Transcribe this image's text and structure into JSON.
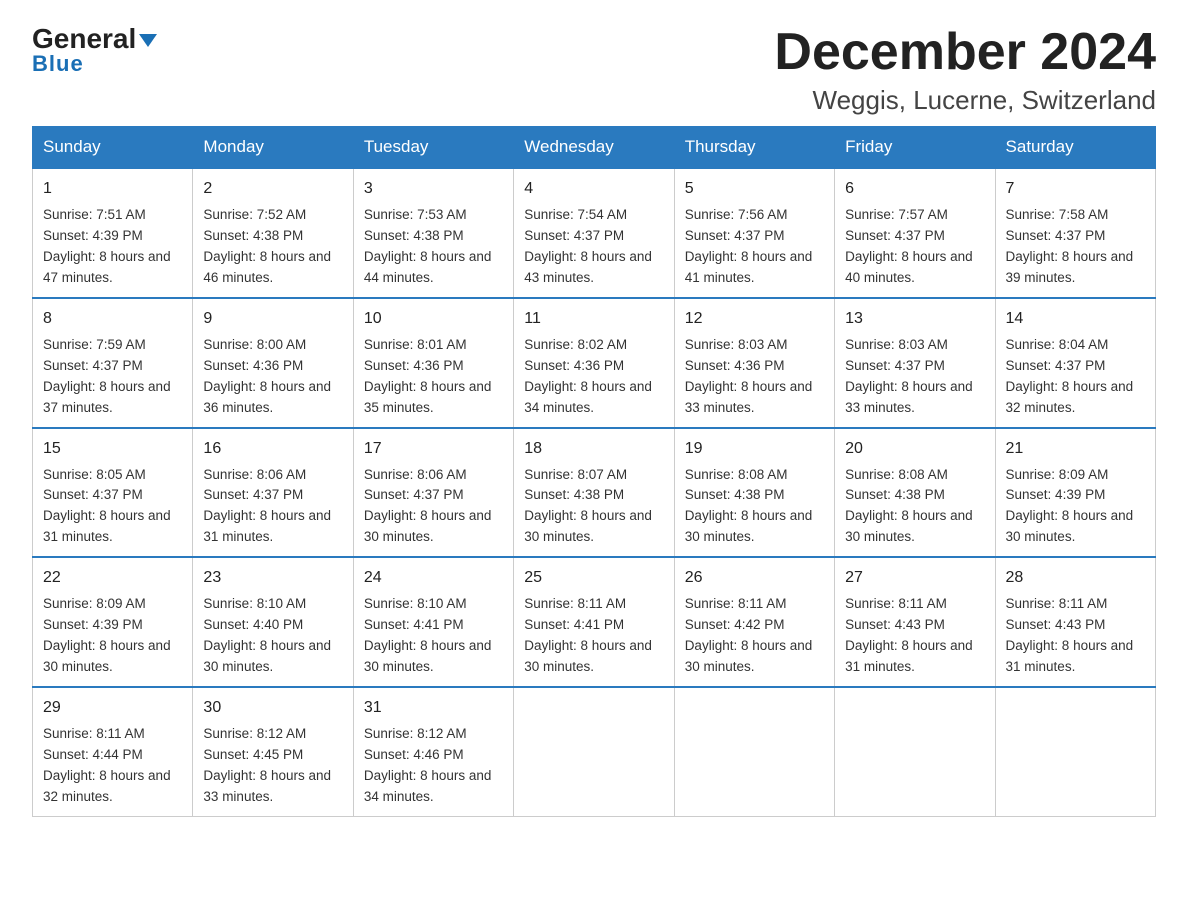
{
  "header": {
    "logo_general": "General",
    "logo_blue": "Blue",
    "title": "December 2024",
    "subtitle": "Weggis, Lucerne, Switzerland"
  },
  "days_of_week": [
    "Sunday",
    "Monday",
    "Tuesday",
    "Wednesday",
    "Thursday",
    "Friday",
    "Saturday"
  ],
  "weeks": [
    [
      {
        "day": "1",
        "sunrise": "Sunrise: 7:51 AM",
        "sunset": "Sunset: 4:39 PM",
        "daylight": "Daylight: 8 hours and 47 minutes."
      },
      {
        "day": "2",
        "sunrise": "Sunrise: 7:52 AM",
        "sunset": "Sunset: 4:38 PM",
        "daylight": "Daylight: 8 hours and 46 minutes."
      },
      {
        "day": "3",
        "sunrise": "Sunrise: 7:53 AM",
        "sunset": "Sunset: 4:38 PM",
        "daylight": "Daylight: 8 hours and 44 minutes."
      },
      {
        "day": "4",
        "sunrise": "Sunrise: 7:54 AM",
        "sunset": "Sunset: 4:37 PM",
        "daylight": "Daylight: 8 hours and 43 minutes."
      },
      {
        "day": "5",
        "sunrise": "Sunrise: 7:56 AM",
        "sunset": "Sunset: 4:37 PM",
        "daylight": "Daylight: 8 hours and 41 minutes."
      },
      {
        "day": "6",
        "sunrise": "Sunrise: 7:57 AM",
        "sunset": "Sunset: 4:37 PM",
        "daylight": "Daylight: 8 hours and 40 minutes."
      },
      {
        "day": "7",
        "sunrise": "Sunrise: 7:58 AM",
        "sunset": "Sunset: 4:37 PM",
        "daylight": "Daylight: 8 hours and 39 minutes."
      }
    ],
    [
      {
        "day": "8",
        "sunrise": "Sunrise: 7:59 AM",
        "sunset": "Sunset: 4:37 PM",
        "daylight": "Daylight: 8 hours and 37 minutes."
      },
      {
        "day": "9",
        "sunrise": "Sunrise: 8:00 AM",
        "sunset": "Sunset: 4:36 PM",
        "daylight": "Daylight: 8 hours and 36 minutes."
      },
      {
        "day": "10",
        "sunrise": "Sunrise: 8:01 AM",
        "sunset": "Sunset: 4:36 PM",
        "daylight": "Daylight: 8 hours and 35 minutes."
      },
      {
        "day": "11",
        "sunrise": "Sunrise: 8:02 AM",
        "sunset": "Sunset: 4:36 PM",
        "daylight": "Daylight: 8 hours and 34 minutes."
      },
      {
        "day": "12",
        "sunrise": "Sunrise: 8:03 AM",
        "sunset": "Sunset: 4:36 PM",
        "daylight": "Daylight: 8 hours and 33 minutes."
      },
      {
        "day": "13",
        "sunrise": "Sunrise: 8:03 AM",
        "sunset": "Sunset: 4:37 PM",
        "daylight": "Daylight: 8 hours and 33 minutes."
      },
      {
        "day": "14",
        "sunrise": "Sunrise: 8:04 AM",
        "sunset": "Sunset: 4:37 PM",
        "daylight": "Daylight: 8 hours and 32 minutes."
      }
    ],
    [
      {
        "day": "15",
        "sunrise": "Sunrise: 8:05 AM",
        "sunset": "Sunset: 4:37 PM",
        "daylight": "Daylight: 8 hours and 31 minutes."
      },
      {
        "day": "16",
        "sunrise": "Sunrise: 8:06 AM",
        "sunset": "Sunset: 4:37 PM",
        "daylight": "Daylight: 8 hours and 31 minutes."
      },
      {
        "day": "17",
        "sunrise": "Sunrise: 8:06 AM",
        "sunset": "Sunset: 4:37 PM",
        "daylight": "Daylight: 8 hours and 30 minutes."
      },
      {
        "day": "18",
        "sunrise": "Sunrise: 8:07 AM",
        "sunset": "Sunset: 4:38 PM",
        "daylight": "Daylight: 8 hours and 30 minutes."
      },
      {
        "day": "19",
        "sunrise": "Sunrise: 8:08 AM",
        "sunset": "Sunset: 4:38 PM",
        "daylight": "Daylight: 8 hours and 30 minutes."
      },
      {
        "day": "20",
        "sunrise": "Sunrise: 8:08 AM",
        "sunset": "Sunset: 4:38 PM",
        "daylight": "Daylight: 8 hours and 30 minutes."
      },
      {
        "day": "21",
        "sunrise": "Sunrise: 8:09 AM",
        "sunset": "Sunset: 4:39 PM",
        "daylight": "Daylight: 8 hours and 30 minutes."
      }
    ],
    [
      {
        "day": "22",
        "sunrise": "Sunrise: 8:09 AM",
        "sunset": "Sunset: 4:39 PM",
        "daylight": "Daylight: 8 hours and 30 minutes."
      },
      {
        "day": "23",
        "sunrise": "Sunrise: 8:10 AM",
        "sunset": "Sunset: 4:40 PM",
        "daylight": "Daylight: 8 hours and 30 minutes."
      },
      {
        "day": "24",
        "sunrise": "Sunrise: 8:10 AM",
        "sunset": "Sunset: 4:41 PM",
        "daylight": "Daylight: 8 hours and 30 minutes."
      },
      {
        "day": "25",
        "sunrise": "Sunrise: 8:11 AM",
        "sunset": "Sunset: 4:41 PM",
        "daylight": "Daylight: 8 hours and 30 minutes."
      },
      {
        "day": "26",
        "sunrise": "Sunrise: 8:11 AM",
        "sunset": "Sunset: 4:42 PM",
        "daylight": "Daylight: 8 hours and 30 minutes."
      },
      {
        "day": "27",
        "sunrise": "Sunrise: 8:11 AM",
        "sunset": "Sunset: 4:43 PM",
        "daylight": "Daylight: 8 hours and 31 minutes."
      },
      {
        "day": "28",
        "sunrise": "Sunrise: 8:11 AM",
        "sunset": "Sunset: 4:43 PM",
        "daylight": "Daylight: 8 hours and 31 minutes."
      }
    ],
    [
      {
        "day": "29",
        "sunrise": "Sunrise: 8:11 AM",
        "sunset": "Sunset: 4:44 PM",
        "daylight": "Daylight: 8 hours and 32 minutes."
      },
      {
        "day": "30",
        "sunrise": "Sunrise: 8:12 AM",
        "sunset": "Sunset: 4:45 PM",
        "daylight": "Daylight: 8 hours and 33 minutes."
      },
      {
        "day": "31",
        "sunrise": "Sunrise: 8:12 AM",
        "sunset": "Sunset: 4:46 PM",
        "daylight": "Daylight: 8 hours and 34 minutes."
      },
      null,
      null,
      null,
      null
    ]
  ]
}
